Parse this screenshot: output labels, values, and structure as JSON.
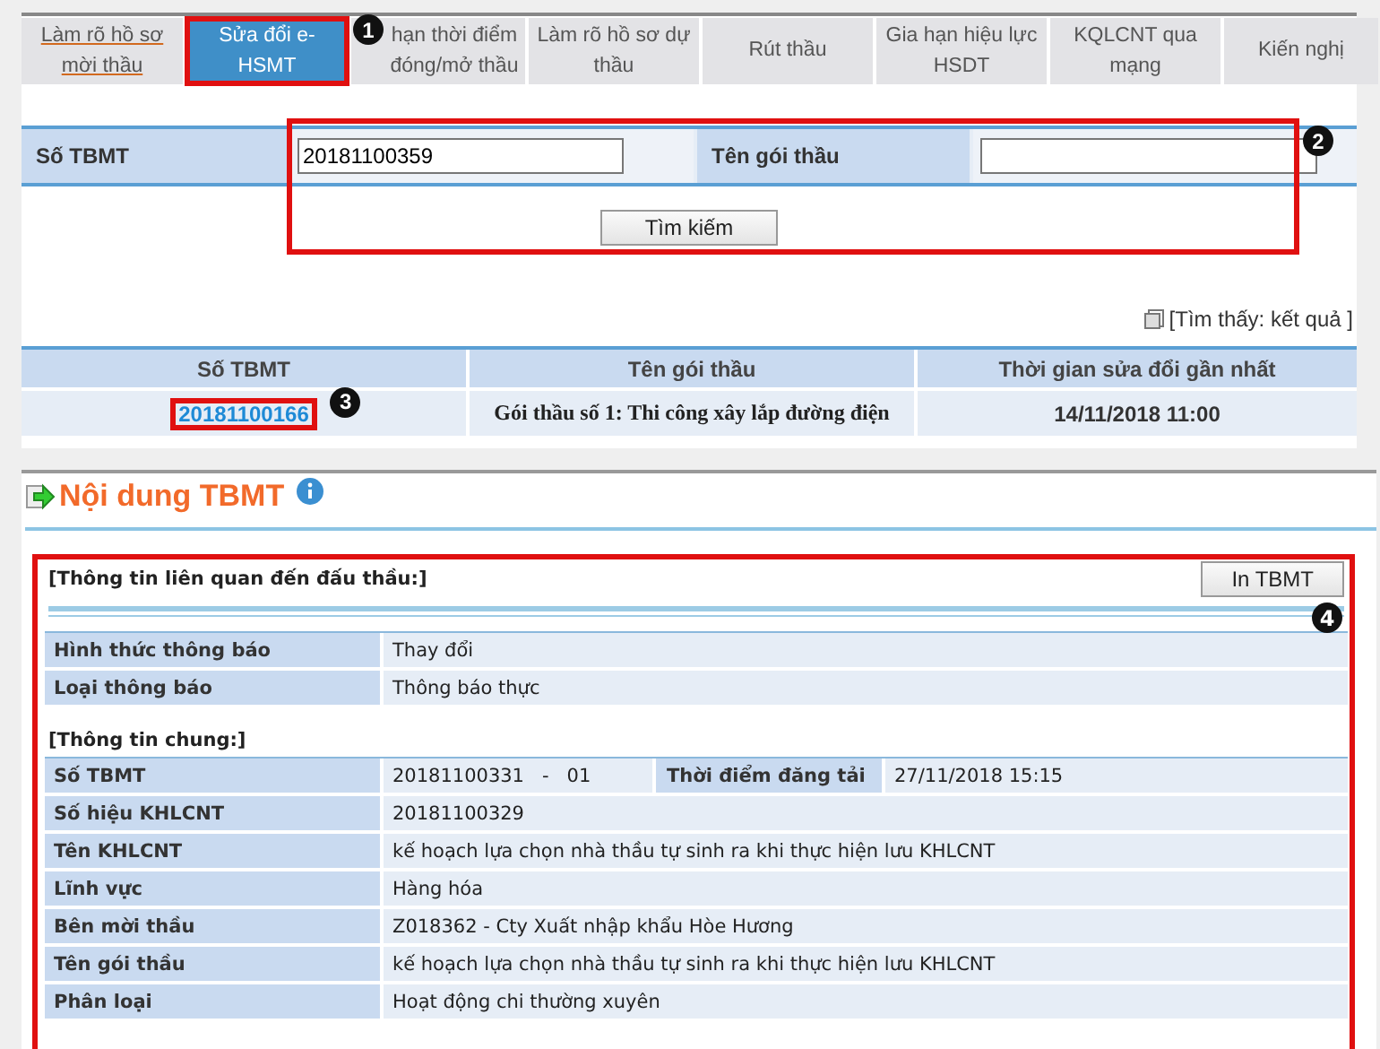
{
  "tabs": [
    {
      "label": "Làm rõ hồ sơ mời thầu",
      "selected": false,
      "underlined": true
    },
    {
      "label": "Sửa đổi e-HSMT",
      "selected": true,
      "underlined": false,
      "highlighted": true,
      "callout": "1"
    },
    {
      "label": "hạn thời điểm đóng/mở thầu",
      "selected": false,
      "underlined": false
    },
    {
      "label": "Làm rõ hồ sơ dự thầu",
      "selected": false,
      "underlined": false
    },
    {
      "label": "Rút thầu",
      "selected": false,
      "underlined": false
    },
    {
      "label": "Gia hạn hiệu lực HSDT",
      "selected": false,
      "underlined": false
    },
    {
      "label": "KQLCNT qua mạng",
      "selected": false,
      "underlined": false
    },
    {
      "label": "Kiến nghị",
      "selected": false,
      "underlined": false
    }
  ],
  "search": {
    "callout": "2",
    "fields": [
      {
        "label": "Số TBMT",
        "value": "20181100359"
      },
      {
        "label": "Tên gói thầu"
      }
    ],
    "button": "Tìm kiếm"
  },
  "result_summary": "[Tìm thấy: kết quả ]",
  "results": {
    "columns": [
      "Số TBMT",
      "Tên gói thầu",
      "Thời gian sửa đổi gần nhất"
    ],
    "rows": [
      {
        "cells": [
          "20181100166",
          "Gói thầu số 1: Thi công xây lắp đường điện",
          "14/11/2018 11:00"
        ],
        "callout": "3"
      }
    ]
  },
  "details": {
    "title": "Nội dung TBMT",
    "callout": "4",
    "print_button": "In TBMT",
    "sections": [
      {
        "heading": "[Thông tin liên quan đến đấu thầu:]",
        "rows": [
          {
            "label": "Hình thức thông báo",
            "value": "Thay đổi"
          },
          {
            "label": "Loại thông báo",
            "value": "Thông báo thực"
          }
        ]
      },
      {
        "heading": "[Thông tin chung:]",
        "rows": [
          {
            "label": "Số TBMT",
            "value": "20181100331   -   01",
            "label_2": "Thời điểm đăng tải",
            "value_2": "27/11/2018 15:15"
          },
          {
            "label": "Số hiệu KHLCNT",
            "value": "20181100329"
          },
          {
            "label": "Tên KHLCNT",
            "value": "kế hoạch lựa chọn nhà thầu tự sinh ra khi thực hiện lưu KHLCNT"
          },
          {
            "label": "Lĩnh vực",
            "value": "Hàng hóa"
          },
          {
            "label": "Bên mời thầu",
            "value": "Z018362 - Cty Xuất nhập khẩu Hòe Hương"
          },
          {
            "label": "Tên gói thầu",
            "value": "kế hoạch lựa chọn nhà thầu tự sinh ra khi thực hiện lưu KHLCNT"
          },
          {
            "label": "Phân loại",
            "value": "Hoạt động chi thường xuyên"
          }
        ]
      }
    ]
  }
}
